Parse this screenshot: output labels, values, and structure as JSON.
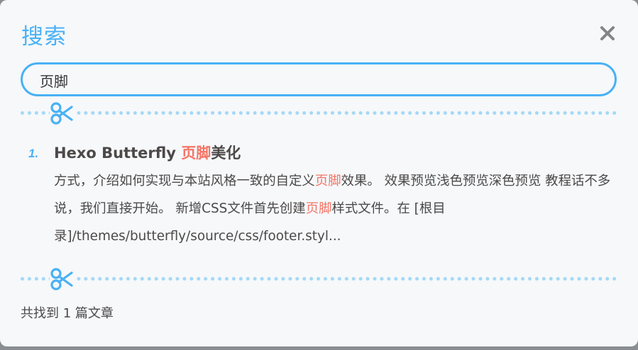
{
  "dialog": {
    "title": "搜索",
    "close_icon": "close-icon"
  },
  "search": {
    "value": "页脚",
    "placeholder": ""
  },
  "results": [
    {
      "index": "1.",
      "title_parts": [
        {
          "text": "Hexo Butterfly ",
          "highlight": false
        },
        {
          "text": "页脚",
          "highlight": true
        },
        {
          "text": "美化",
          "highlight": false
        }
      ],
      "excerpt_parts": [
        {
          "text": "方式，介绍如何实现与本站风格一致的自定义",
          "highlight": false
        },
        {
          "text": "页脚",
          "highlight": true
        },
        {
          "text": "效果。 效果预览浅色预览深色预览 教程话不多说，我们直接开始。 新增CSS文件首先创建",
          "highlight": false
        },
        {
          "text": "页脚",
          "highlight": true
        },
        {
          "text": "样式文件。在 [根目录]/themes/butterfly/source/css/footer.styl...",
          "highlight": false
        }
      ]
    }
  ],
  "footer": {
    "count_text": "共找到 1 篇文章"
  },
  "colors": {
    "accent": "#49b1f5",
    "highlight": "#f47466",
    "text": "#4c4948",
    "divider": "#a5d8f5"
  }
}
